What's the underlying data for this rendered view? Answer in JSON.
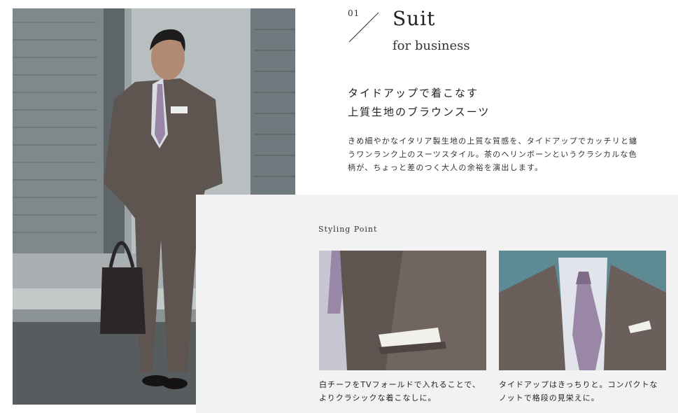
{
  "section": {
    "number": "01",
    "title": "Suit",
    "subtitle": "for business"
  },
  "headline": "タイドアップで着こなす\n上質生地のブラウンスーツ",
  "description": "きめ細やかなイタリア製生地の上質な質感を、タイドアップでカッチリと纏\nうワンランク上のスーツスタイル。茶のヘリンボーンというクラシカルな色\n柄が、ちょっと差のつく大人の余裕を演出します。",
  "styling": {
    "label": "Styling Point",
    "points": [
      {
        "caption": "白チーフをTVフォールドで入れることで、\nよりクラシックな着こなしに。"
      },
      {
        "caption": "タイドアップはきっちりと。コンパクトな\nノットで格段の見栄えに。"
      }
    ]
  },
  "colors": {
    "suit": "#5f5550",
    "tie": "#9a86a6",
    "panel": "#f2f2f2",
    "text": "#222222"
  }
}
